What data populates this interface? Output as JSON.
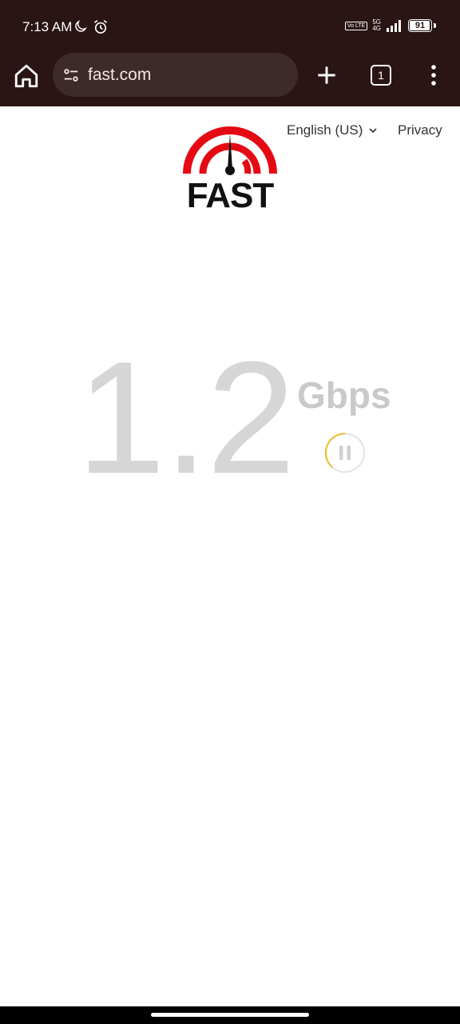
{
  "status_bar": {
    "time": "7:13 AM",
    "volte": "Vo LTE",
    "network": "5G",
    "network_sub": "4G",
    "battery_level": 91,
    "battery_text": "91"
  },
  "browser": {
    "url": "fast.com",
    "tab_count": "1",
    "colors": {
      "toolbar_bg": "#2a1414",
      "omnibox_bg": "#3f2a2a"
    }
  },
  "page": {
    "language_label": "English (US)",
    "privacy_label": "Privacy",
    "logo_text": "FAST",
    "speed_value": "1.2",
    "speed_unit": "Gbps",
    "colors": {
      "brand_red": "#e50914",
      "ring_yellow": "#e8c33a"
    }
  }
}
